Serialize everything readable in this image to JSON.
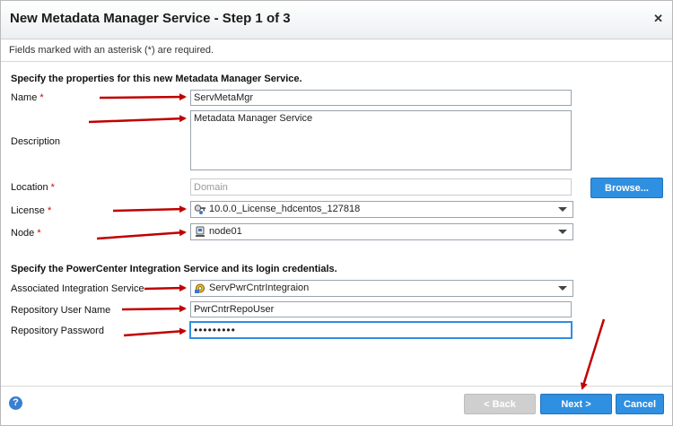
{
  "dialog": {
    "title": "New Metadata Manager Service - Step 1 of 3",
    "close_glyph": "✕",
    "required_hint": "Fields marked with an asterisk (*) are required."
  },
  "section1": {
    "heading": "Specify the properties for this new Metadata Manager Service.",
    "name": {
      "label": "Name",
      "value": "ServMetaMgr"
    },
    "description": {
      "label": "Description",
      "value": "Metadata Manager Service"
    },
    "location": {
      "label": "Location",
      "value": "Domain",
      "browse_label": "Browse..."
    },
    "license": {
      "label": "License",
      "value": "10.0.0_License_hdcentos_127818",
      "icon": "key-icon"
    },
    "node": {
      "label": "Node",
      "value": "node01",
      "icon": "server-node-icon"
    },
    "required_marker": "*"
  },
  "section2": {
    "heading": "Specify the PowerCenter Integration Service and its login credentials.",
    "integration_service": {
      "label": "Associated Integration Service",
      "value": "ServPwrCntrIntegraion",
      "icon": "integration-service-icon"
    },
    "repo_user": {
      "label": "Repository User Name",
      "value": "PwrCntrRepoUser"
    },
    "repo_password": {
      "label": "Repository Password",
      "value": "•••••••••"
    }
  },
  "footer": {
    "help_glyph": "?",
    "back_label": "< Back",
    "next_label": "Next >",
    "cancel_label": "Cancel"
  },
  "colors": {
    "accent": "#2f8fe0",
    "annotation_arrow": "#c00000",
    "required": "#d40000"
  }
}
